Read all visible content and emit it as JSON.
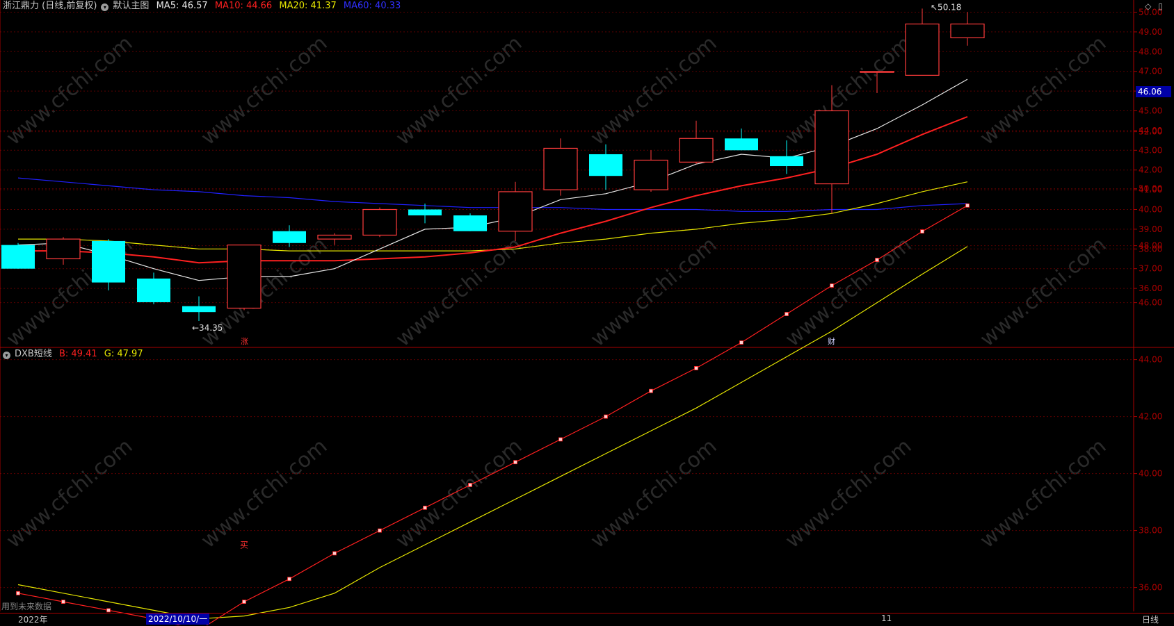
{
  "header": {
    "stock": "浙江鼎力 (日线,前复权)",
    "template": "默认主图",
    "ma5_label": "MA5: 46.57",
    "ma10_label": "MA10: 44.66",
    "ma20_label": "MA20: 41.37",
    "ma60_label": "MA60: 40.33"
  },
  "sub_header": {
    "name": "DXB短线",
    "b_label": "B: 49.41",
    "g_label": "G: 47.97"
  },
  "colors": {
    "up": "#ff3c3c",
    "down": "#00ffff",
    "ma5": "#e6e6e6",
    "ma10": "#ff2020",
    "ma20": "#e6e600",
    "ma60": "#2020ff",
    "b_line": "#ff2020",
    "g_line": "#e6e600"
  },
  "axis": {
    "price_ticks": [
      "50.00",
      "49.00",
      "48.00",
      "47.00",
      "46.00",
      "45.00",
      "44.00",
      "43.00",
      "42.00",
      "41.00",
      "40.00",
      "39.00",
      "38.00",
      "37.00",
      "36.00"
    ],
    "sub_ticks": [
      "52.00",
      "50.00",
      "48.00",
      "46.00",
      "44.00",
      "42.00",
      "40.00",
      "38.00",
      "36.00"
    ],
    "current_price": "46.06",
    "year_label": "2022年",
    "date_label": "2022/10/10/一",
    "month_label": "11",
    "period_label": "日线"
  },
  "markers": {
    "high_label": "50.18",
    "low_label": "34.35",
    "zhang": "涨",
    "cai": "财",
    "mai": "买"
  },
  "footer_note": "用到未来数据",
  "chart_data": [
    {
      "type": "candlestick",
      "title": "浙江鼎力 (日线,前复权)",
      "ylim": [
        34,
        51
      ],
      "candles": [
        {
          "o": 38.2,
          "h": 38.3,
          "l": 37.0,
          "c": 37.0
        },
        {
          "o": 37.5,
          "h": 38.6,
          "l": 37.2,
          "c": 38.5
        },
        {
          "o": 38.4,
          "h": 38.5,
          "l": 35.9,
          "c": 36.3
        },
        {
          "o": 36.5,
          "h": 36.8,
          "l": 35.2,
          "c": 35.3
        },
        {
          "o": 35.1,
          "h": 35.6,
          "l": 34.35,
          "c": 34.8
        },
        {
          "o": 35.0,
          "h": 38.2,
          "l": 34.9,
          "c": 38.2
        },
        {
          "o": 38.9,
          "h": 39.2,
          "l": 38.1,
          "c": 38.3
        },
        {
          "o": 38.5,
          "h": 38.8,
          "l": 38.2,
          "c": 38.7
        },
        {
          "o": 38.7,
          "h": 40.1,
          "l": 38.6,
          "c": 40.0
        },
        {
          "o": 40.0,
          "h": 40.3,
          "l": 39.3,
          "c": 39.7
        },
        {
          "o": 39.7,
          "h": 39.8,
          "l": 38.9,
          "c": 38.9
        },
        {
          "o": 38.9,
          "h": 41.4,
          "l": 38.4,
          "c": 40.9
        },
        {
          "o": 41.0,
          "h": 43.6,
          "l": 40.7,
          "c": 43.1
        },
        {
          "o": 42.8,
          "h": 43.3,
          "l": 41.0,
          "c": 41.7
        },
        {
          "o": 41.0,
          "h": 43.0,
          "l": 40.9,
          "c": 42.5
        },
        {
          "o": 42.4,
          "h": 44.5,
          "l": 42.3,
          "c": 43.6
        },
        {
          "o": 43.6,
          "h": 44.1,
          "l": 43.0,
          "c": 43.0
        },
        {
          "o": 42.7,
          "h": 43.5,
          "l": 41.8,
          "c": 42.2
        },
        {
          "o": 41.3,
          "h": 46.3,
          "l": 39.8,
          "c": 45.0
        },
        {
          "o": 47.0,
          "h": 47.0,
          "l": 45.9,
          "c": 47.0
        },
        {
          "o": 46.8,
          "h": 50.18,
          "l": 46.8,
          "c": 49.4
        },
        {
          "o": 48.7,
          "h": 50.0,
          "l": 48.3,
          "c": 49.4
        }
      ],
      "ma5": [
        38.2,
        38.3,
        37.7,
        37.0,
        36.4,
        36.6,
        36.6,
        37.0,
        38.0,
        39.0,
        39.1,
        39.6,
        40.5,
        40.8,
        41.4,
        42.3,
        42.8,
        42.6,
        43.2,
        44.1,
        45.3,
        46.6
      ],
      "ma10": [
        37.9,
        37.9,
        37.8,
        37.6,
        37.3,
        37.4,
        37.4,
        37.4,
        37.5,
        37.6,
        37.8,
        38.1,
        38.8,
        39.4,
        40.1,
        40.7,
        41.2,
        41.6,
        42.1,
        42.8,
        43.8,
        44.7
      ],
      "ma20": [
        38.5,
        38.5,
        38.4,
        38.2,
        38.0,
        38.0,
        37.9,
        37.9,
        37.9,
        37.9,
        37.9,
        38.0,
        38.3,
        38.5,
        38.8,
        39.0,
        39.3,
        39.5,
        39.8,
        40.3,
        40.9,
        41.4
      ],
      "ma60": [
        41.6,
        41.4,
        41.2,
        41.0,
        40.9,
        40.7,
        40.6,
        40.4,
        40.3,
        40.2,
        40.1,
        40.1,
        40.1,
        40.0,
        40.0,
        40.0,
        39.9,
        39.9,
        40.0,
        40.0,
        40.2,
        40.3
      ]
    },
    {
      "type": "line",
      "title": "DXB短线",
      "ylim": [
        35,
        53
      ],
      "series": [
        {
          "name": "B",
          "values": [
            35.8,
            35.5,
            35.2,
            34.9,
            34.5,
            35.5,
            36.3,
            37.2,
            38.0,
            38.8,
            39.6,
            40.4,
            41.2,
            42.0,
            42.9,
            43.7,
            44.6,
            45.6,
            46.6,
            47.5,
            48.5,
            49.41
          ],
          "color": "#ff2020"
        },
        {
          "name": "G",
          "values": [
            36.1,
            35.8,
            35.5,
            35.2,
            34.9,
            35.0,
            35.3,
            35.8,
            36.7,
            37.5,
            38.3,
            39.1,
            39.9,
            40.7,
            41.5,
            42.3,
            43.2,
            44.1,
            45.0,
            46.0,
            47.0,
            47.97
          ],
          "color": "#e6e600"
        }
      ]
    }
  ]
}
